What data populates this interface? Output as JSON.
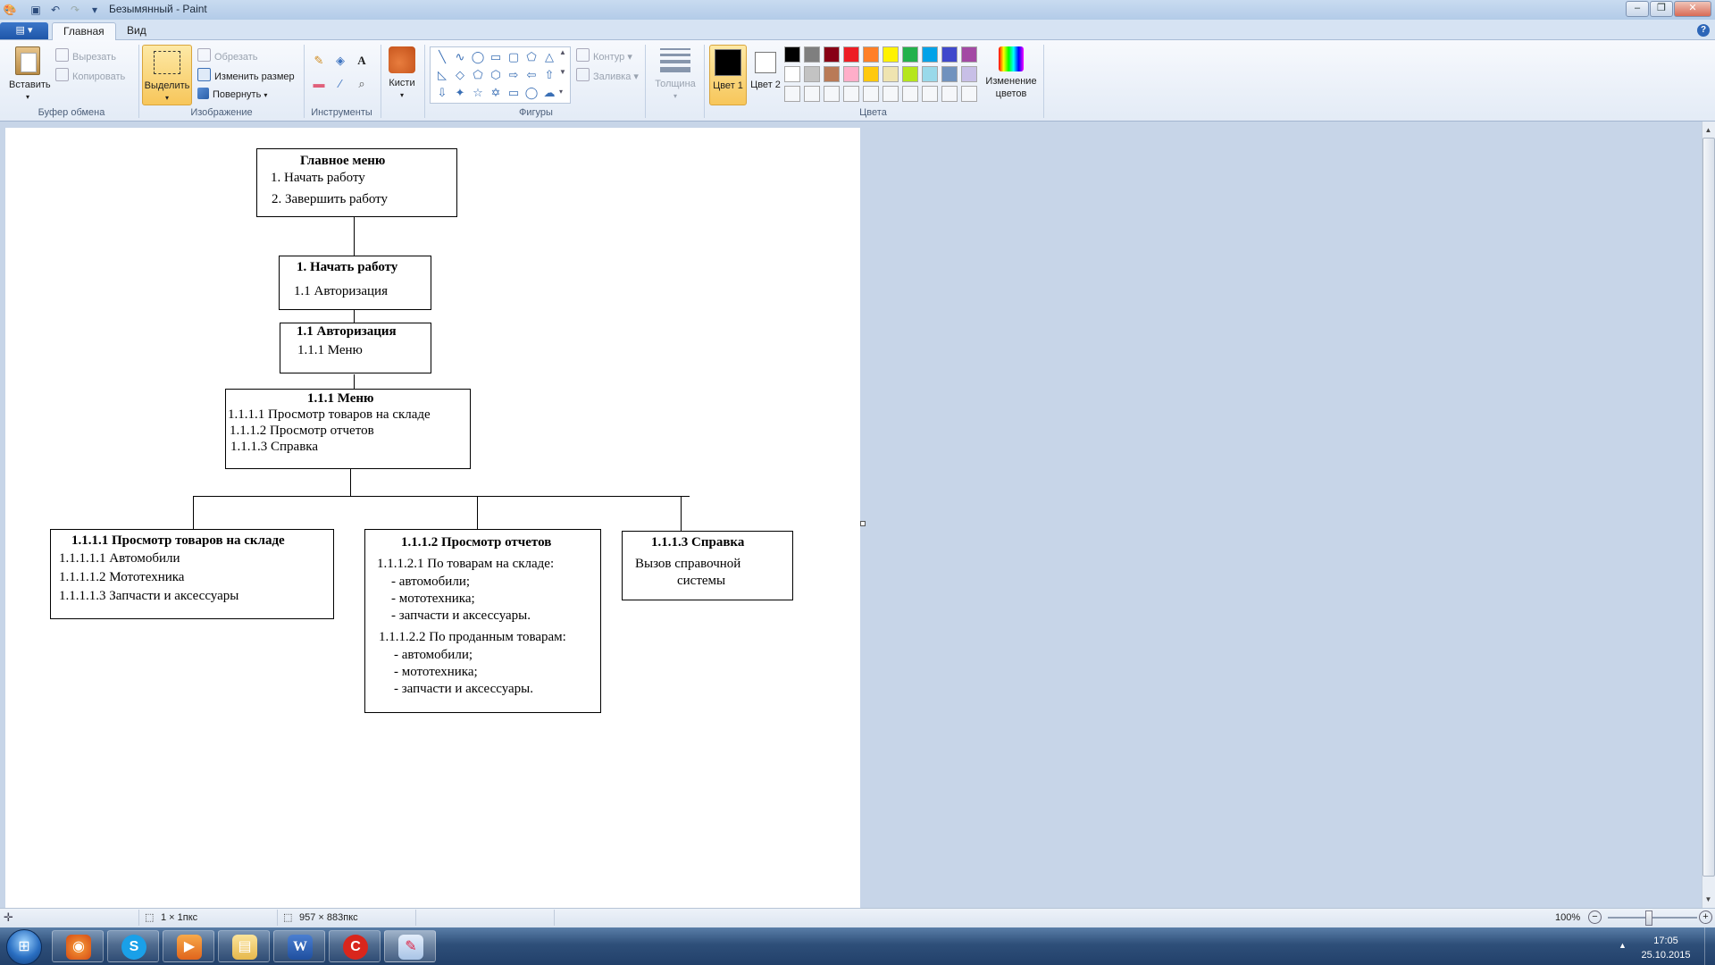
{
  "window": {
    "title": "Безымянный - Paint",
    "buttons": [
      "minimize",
      "maximize",
      "close"
    ]
  },
  "ribbon": {
    "file_label": "▤ ▾",
    "tabs": [
      {
        "label": "Главная"
      },
      {
        "label": "Вид"
      }
    ],
    "clipboard": {
      "paste": "Вставить",
      "cut": "Вырезать",
      "copy": "Копировать",
      "group": "Буфер обмена"
    },
    "image": {
      "select": "Выделить",
      "crop": "Обрезать",
      "resize": "Изменить размер",
      "rotate": "Повернуть",
      "group": "Изображение"
    },
    "tools": {
      "group": "Инструменты"
    },
    "brushes": {
      "label": "Кисти"
    },
    "shapes": {
      "outline": "Контур",
      "fill": "Заливка",
      "group": "Фигуры"
    },
    "size": {
      "label": "Толщина"
    },
    "colors": {
      "color1": "Цвет 1",
      "color2": "Цвет 2",
      "edit": "Изменение цветов",
      "group": "Цвета",
      "palette_row1": [
        "#000000",
        "#7f7f7f",
        "#880015",
        "#ed1c24",
        "#ff7f27",
        "#fff200",
        "#22b14c",
        "#00a2e8",
        "#3f48cc",
        "#a349a4"
      ],
      "palette_row2": [
        "#ffffff",
        "#c3c3c3",
        "#b97a57",
        "#ffaec9",
        "#ffc90e",
        "#efe4b0",
        "#b5e61d",
        "#99d9ea",
        "#7092be",
        "#c8bfe7"
      ]
    }
  },
  "diagram": {
    "main": {
      "title": "Главное меню",
      "lines": [
        "1. Начать работу",
        "2. Завершить работу"
      ]
    },
    "start": {
      "title": "1. Начать работу",
      "lines": [
        "1.1 Авторизация"
      ]
    },
    "auth": {
      "title": "1.1 Авторизация",
      "lines": [
        "1.1.1 Меню"
      ]
    },
    "menu": {
      "title": "1.1.1 Меню",
      "lines": [
        "1.1.1.1 Просмотр товаров на складе",
        "1.1.1.2 Просмотр отчетов",
        "1.1.1.3 Справка"
      ]
    },
    "goods": {
      "title": "1.1.1.1 Просмотр товаров на складе",
      "lines": [
        "1.1.1.1.1 Автомобили",
        "1.1.1.1.2 Мототехника",
        "1.1.1.1.3 Запчасти и аксессуары"
      ]
    },
    "reports": {
      "title": "1.1.1.2 Просмотр отчетов",
      "lines": [
        "1.1.1.2.1 По товарам на складе:",
        "- автомобили;",
        "- мототехника;",
        "- запчасти и аксессуары.",
        "1.1.1.2.2 По проданным товарам:",
        "- автомобили;",
        "- мототехника;",
        "- запчасти и аксессуары."
      ]
    },
    "help": {
      "title": "1.1.1.3 Справка",
      "lines": [
        "Вызов справочной",
        "системы"
      ]
    }
  },
  "statusbar": {
    "selection": "1 × 1пкс",
    "size": "957 × 883пкс",
    "zoom": "100%"
  },
  "taskbar": {
    "time": "17:05",
    "date": "25.10.2015"
  }
}
